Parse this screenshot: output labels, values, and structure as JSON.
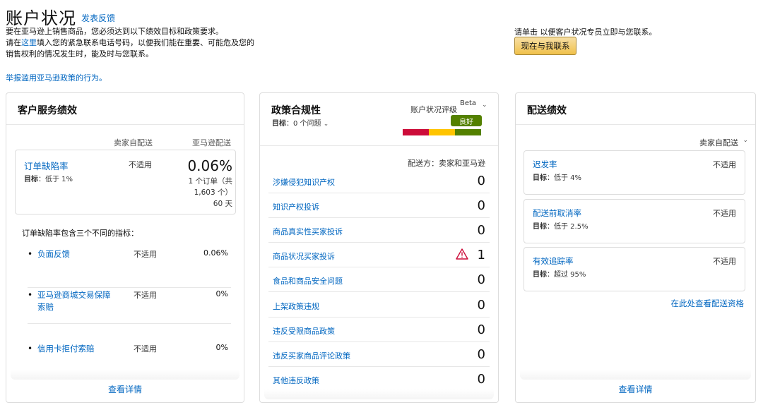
{
  "header": {
    "title": "账户状况",
    "feedback_link": "发表反馈",
    "desc_line1": "要在亚马逊上销售商品，您必须达到以下绩效目标和政策要求。",
    "desc_line2_pre": "请在",
    "desc_line2_link": "这里",
    "desc_line2_post": "填入您的紧急联系电话号码，以便我们能在重要、可能危及您的销售权利的情况发生时，能及时与您联系。",
    "report_link": "举报滥用亚马逊政策的行为。",
    "right_text": "请单击 以便客户状况专员立即与您联系。",
    "contact_button": "现在与我联系"
  },
  "customer_service": {
    "title": "客户服务绩效",
    "col_seller": "卖家自配送",
    "col_amazon": "亚马逊配送",
    "odr": {
      "label": "订单缺陷率",
      "target_label": "目标",
      "target_value": "：低于 1%",
      "seller_value": "不适用",
      "amazon_value": "0.06%",
      "detail": "1 个订单（共 1,603 个）",
      "period": "60 天"
    },
    "intro": "订单缺陷率包含三个不同的指标：",
    "metrics": [
      {
        "name": "负面反馈",
        "seller": "不适用",
        "amazon": "0.06%"
      },
      {
        "name": "亚马逊商城交易保障索赔",
        "seller": "不适用",
        "amazon": "0%"
      },
      {
        "name": "信用卡拒付索赔",
        "seller": "不适用",
        "amazon": "0%"
      }
    ],
    "view_details": "查看详情"
  },
  "policy": {
    "title": "政策合规性",
    "target_label": "目标",
    "target_value": "：0 个问题",
    "rating_label": "账户状况评级",
    "beta": "Beta",
    "rating_value": "良好",
    "rating_colors": [
      "#cc0c39",
      "#ffc400",
      "#538000"
    ],
    "ship_by": "配送方：卖家和亚马逊",
    "rows": [
      {
        "name": "涉嫌侵犯知识产权",
        "value": "0",
        "warning": false
      },
      {
        "name": "知识产权投诉",
        "value": "0",
        "warning": false
      },
      {
        "name": "商品真实性买家投诉",
        "value": "0",
        "warning": false
      },
      {
        "name": "商品状况买家投诉",
        "value": "1",
        "warning": true
      },
      {
        "name": "食品和商品安全问题",
        "value": "0",
        "warning": false
      },
      {
        "name": "上架政策违规",
        "value": "0",
        "warning": false
      },
      {
        "name": "违反受限商品政策",
        "value": "0",
        "warning": false
      },
      {
        "name": "违反买家商品评论政策",
        "value": "0",
        "warning": false
      },
      {
        "name": "其他违反政策",
        "value": "0",
        "warning": false
      }
    ]
  },
  "shipping": {
    "title": "配送绩效",
    "filter": "卖家自配送",
    "target_label": "目标",
    "metrics": [
      {
        "name": "迟发率",
        "target": "：低于 4%",
        "value": "不适用"
      },
      {
        "name": "配送前取消率",
        "target": "：低于 2.5%",
        "value": "不适用"
      },
      {
        "name": "有效追踪率",
        "target": "：超过 95%",
        "value": "不适用"
      }
    ],
    "eligibility_link": "在此处查看配送资格",
    "view_details": "查看详情"
  }
}
